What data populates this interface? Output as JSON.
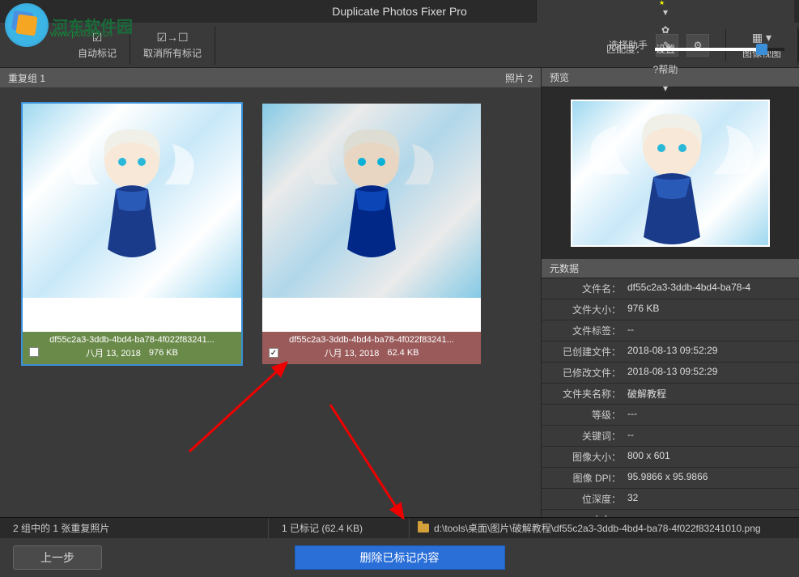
{
  "titlebar": {
    "title": "Duplicate Photos Fixer Pro",
    "settings": "设置",
    "help": "?帮助"
  },
  "watermark": {
    "text": "河东软件园",
    "url": "www.pc0359.cn"
  },
  "toolbar": {
    "auto_mark": "自动标记",
    "unmark_all": "取消所有标记",
    "select_helper": "选择助手",
    "image_view": "图像视图",
    "match_level": "匹配度："
  },
  "group": {
    "title": "重复组 1",
    "count_label": "照片 2"
  },
  "photos": [
    {
      "name": "df55c2a3-3ddb-4bd4-ba78-4f022f83241...",
      "date": "八月 13, 2018",
      "size": "976 KB",
      "checked": false,
      "color": "green",
      "selected": true
    },
    {
      "name": "df55c2a3-3ddb-4bd4-ba78-4f022f83241...",
      "date": "八月 13, 2018",
      "size": "62.4 KB",
      "checked": true,
      "color": "red",
      "selected": false
    }
  ],
  "sidebar": {
    "preview": "预览",
    "metadata": "元数据",
    "rows": [
      {
        "k": "文件名：",
        "v": "df55c2a3-3ddb-4bd4-ba78-4"
      },
      {
        "k": "文件大小：",
        "v": "976 KB"
      },
      {
        "k": "文件标签：",
        "v": "--"
      },
      {
        "k": "已创建文件：",
        "v": "2018-08-13 09:52:29"
      },
      {
        "k": "已修改文件：",
        "v": "2018-08-13 09:52:29"
      },
      {
        "k": "文件夹名称：",
        "v": "破解教程"
      },
      {
        "k": "等级：",
        "v": "---"
      },
      {
        "k": "关键词：",
        "v": "--"
      },
      {
        "k": "图像大小：",
        "v": "800 x 601"
      },
      {
        "k": "图像 DPI：",
        "v": "95.9866 x 95.9866"
      },
      {
        "k": "位深度：",
        "v": "32"
      },
      {
        "k": "方向：",
        "v": "--"
      }
    ]
  },
  "status": {
    "group_summary": "2 组中的 1 张重复照片",
    "marked_summary": "1 已标记 (62.4 KB)",
    "path": "d:\\tools\\桌面\\图片\\破解教程\\df55c2a3-3ddb-4bd4-ba78-4f022f83241010.png"
  },
  "buttons": {
    "prev": "上一步",
    "delete": "删除已标记内容"
  }
}
